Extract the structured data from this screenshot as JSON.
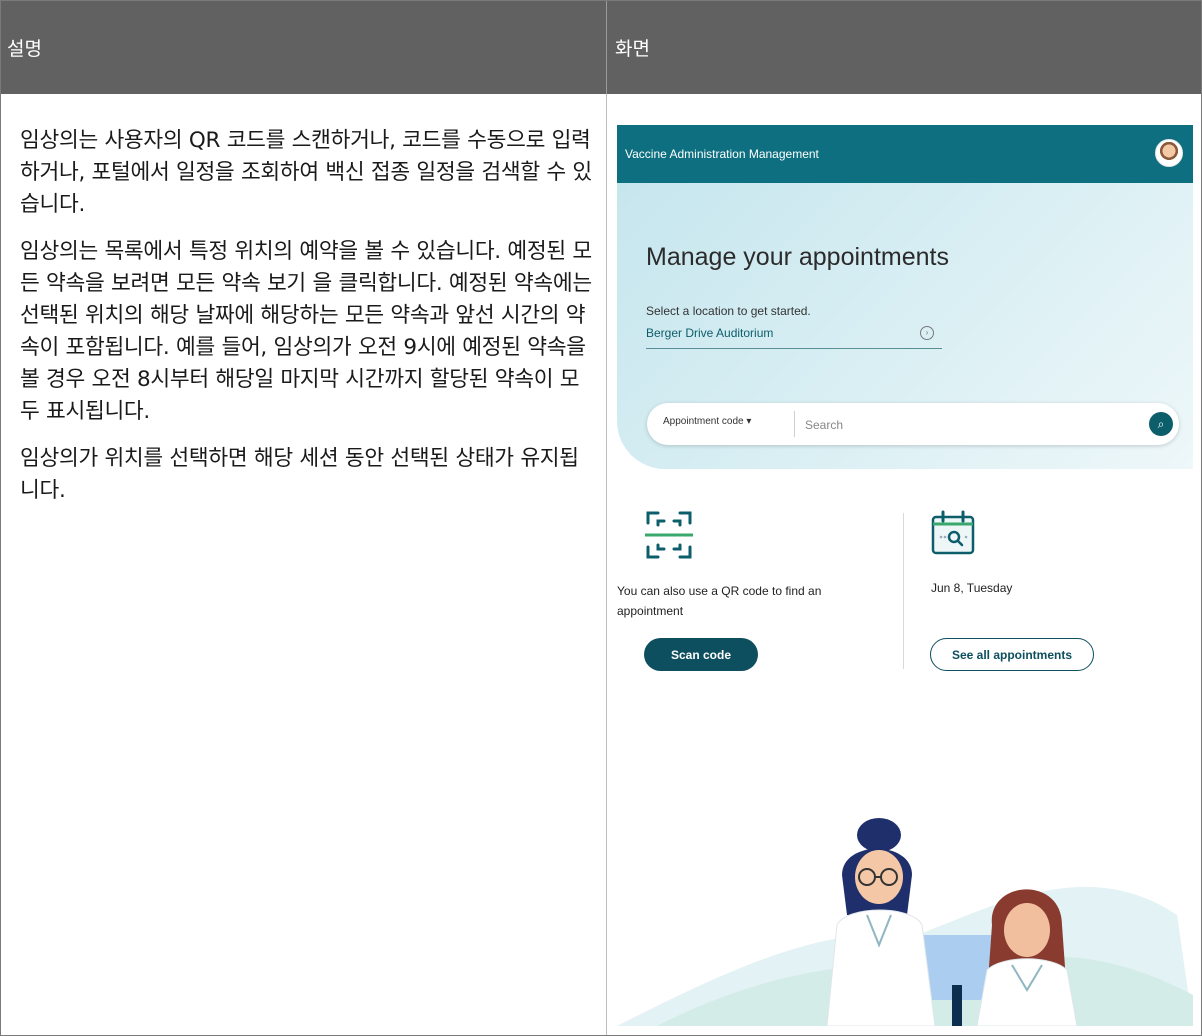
{
  "table": {
    "header_description": "설명",
    "header_screen": "화면"
  },
  "description": {
    "paragraphs": [
      "임상의는 사용자의 QR 코드를 스캔하거나, 코드를 수동으로 입력하거나, 포털에서 일정을 조회하여 백신 접종 일정을 검색할 수 있습니다.",
      "임상의는 목록에서 특정 위치의 예약을 볼 수 있습니다. 예정된 모든 약속을 보려면 모든 약속 보기 을 클릭합니다. 예정된 약속에는 선택된 위치의 해당 날짜에 해당하는 모든 약속과 앞선 시간의 약속이 포함됩니다. 예를 들어, 임상의가 오전 9시에 예정된 약속을 볼 경우 오전 8시부터 해당일 마지막 시간까지 할당된 약속이 모두 표시됩니다.",
      "임상의가 위치를 선택하면 해당 세션 동안 선택된 상태가 유지됩니다."
    ]
  },
  "app": {
    "title": "Vaccine Administration Management",
    "hero_title": "Manage your appointments",
    "location_prompt": "Select a location to get started.",
    "selected_location": "Berger Drive Auditorium",
    "search_type": "Appointment code ▾",
    "search_placeholder": "Search",
    "qr_text": "You can also use a QR code to find an appointment",
    "scan_button": "Scan code",
    "date_text": "Jun 8, Tuesday",
    "see_all_button": "See all appointments"
  },
  "icons": {
    "avatar": "avatar",
    "location_dropdown": "chevron-circle-icon",
    "search": "search-icon",
    "qr": "qr-scan-icon",
    "calendar": "calendar-search-icon"
  },
  "colors": {
    "header_bg": "#616161",
    "app_topbar": "#0d6f7f",
    "primary_button": "#0d4f5e",
    "hero_bg": "#d7eef3"
  }
}
